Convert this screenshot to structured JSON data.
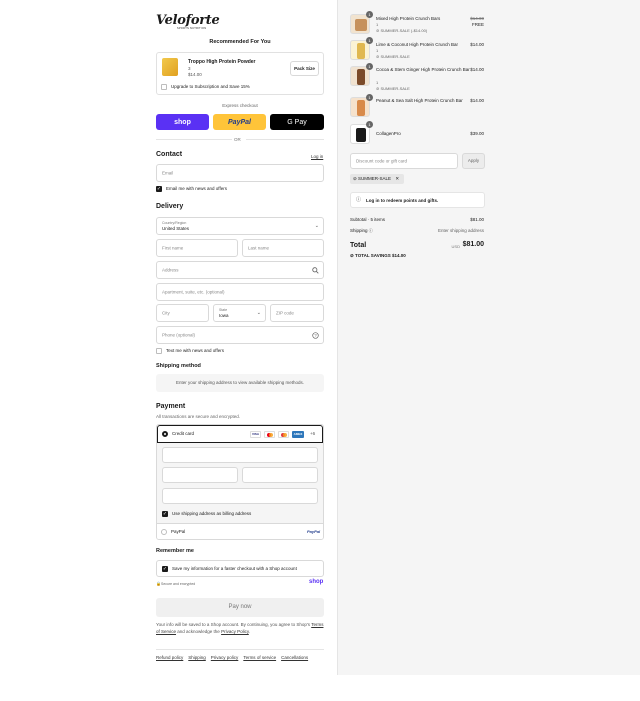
{
  "brand": {
    "logo_text": "Veloforte",
    "logo_sub": "SPORTS NUTRITION"
  },
  "recommended": {
    "title": "Recommended For You",
    "product_name": "Troppo High Protein Powder",
    "product_qty": "3",
    "product_price": "$14.00",
    "pack_size_label": "Pack Size",
    "subscription_label": "Upgrade to Subscription and Save 15%"
  },
  "express": {
    "label": "Express checkout",
    "shop_label": "shop",
    "paypal_label": "PayPal",
    "gpay_label": "G Pay",
    "or_label": "OR"
  },
  "contact": {
    "heading": "Contact",
    "login_link": "Log in",
    "email_placeholder": "Email",
    "news_label": "Email me with news and offers"
  },
  "delivery": {
    "heading": "Delivery",
    "country_label": "Country/Region",
    "country_value": "United States",
    "first_name_placeholder": "First name",
    "last_name_placeholder": "Last name",
    "address_placeholder": "Address",
    "apartment_placeholder": "Apartment, suite, etc. (optional)",
    "city_placeholder": "City",
    "state_label": "State",
    "state_value": "Iowa",
    "zip_placeholder": "ZIP code",
    "phone_placeholder": "Phone (optional)",
    "text_label": "Text me with news and offers"
  },
  "shipping": {
    "heading": "Shipping method",
    "message": "Enter your shipping address to view available shipping methods."
  },
  "payment": {
    "heading": "Payment",
    "subtitle": "All transactions are secure and encrypted.",
    "credit_card_label": "Credit card",
    "more_cards": "+6",
    "billing_label": "Use shipping address as billing address",
    "paypal_label": "PayPal",
    "card_logos": [
      "VISA",
      "MC",
      "MAE",
      "AMEX"
    ]
  },
  "remember": {
    "heading": "Remember me",
    "save_label": "Save my information for a faster checkout with a Shop account",
    "secure_label": "Secure and encrypted",
    "shop_label": "shop"
  },
  "pay_now": {
    "button_label": "Pay now",
    "legal_text": "Your info will be saved to a Shop account. By continuing, you agree to Shop's",
    "terms_link": "Terms of Service",
    "and_text": "and acknowledge the",
    "privacy_link": "Privacy Policy",
    "period": "."
  },
  "footer": {
    "links": [
      "Refund policy",
      "Shipping",
      "Privacy policy",
      "Terms of service",
      "Cancellations"
    ]
  },
  "cart": {
    "items": [
      {
        "name": "Mixed High Protein Crunch Bars",
        "qty": "1",
        "sub1": "1",
        "sub2": "SUMMER-SALE (-$14.00)",
        "price_old": "$14.00",
        "price": "FREE",
        "badge": "1"
      },
      {
        "name": "Lime & Coconut High Protein Crunch Bar",
        "qty": "1",
        "sub1": "1",
        "sub2": "SUMMER-SALE",
        "price": "$14.00",
        "badge": "1"
      },
      {
        "name": "Cocoa & Stem Ginger High Protein Crunch Bar",
        "qty": "1",
        "sub1": "1",
        "sub2": "SUMMER-SALE",
        "price": "$14.00",
        "badge": "1"
      },
      {
        "name": "Peanut & Sea Salt High Protein Crunch Bar",
        "qty": "1",
        "sub1": "",
        "sub2": "",
        "price": "$14.00",
        "badge": "1"
      },
      {
        "name": "CollagenPro",
        "qty": "1",
        "sub1": "",
        "sub2": "",
        "price": "$39.00",
        "badge": "1"
      }
    ],
    "discount_placeholder": "Discount code or gift card",
    "apply_label": "Apply",
    "applied_code": "SUMMER-SALE",
    "points_label": "Log in to redeem points and gifts.",
    "subtotal_label": "Subtotal · 5 items",
    "subtotal_value": "$81.00",
    "shipping_label": "Shipping",
    "shipping_value": "Enter shipping address",
    "total_label": "Total",
    "currency": "USD",
    "total_value": "$81.00",
    "savings_label": "TOTAL SAVINGS",
    "savings_value": "$14.00"
  },
  "colors": {
    "shop_purple": "#5a31f4",
    "paypal_yellow": "#ffc439",
    "gpay_black": "#000000",
    "pay_now_bg": "#f0f0f0"
  }
}
